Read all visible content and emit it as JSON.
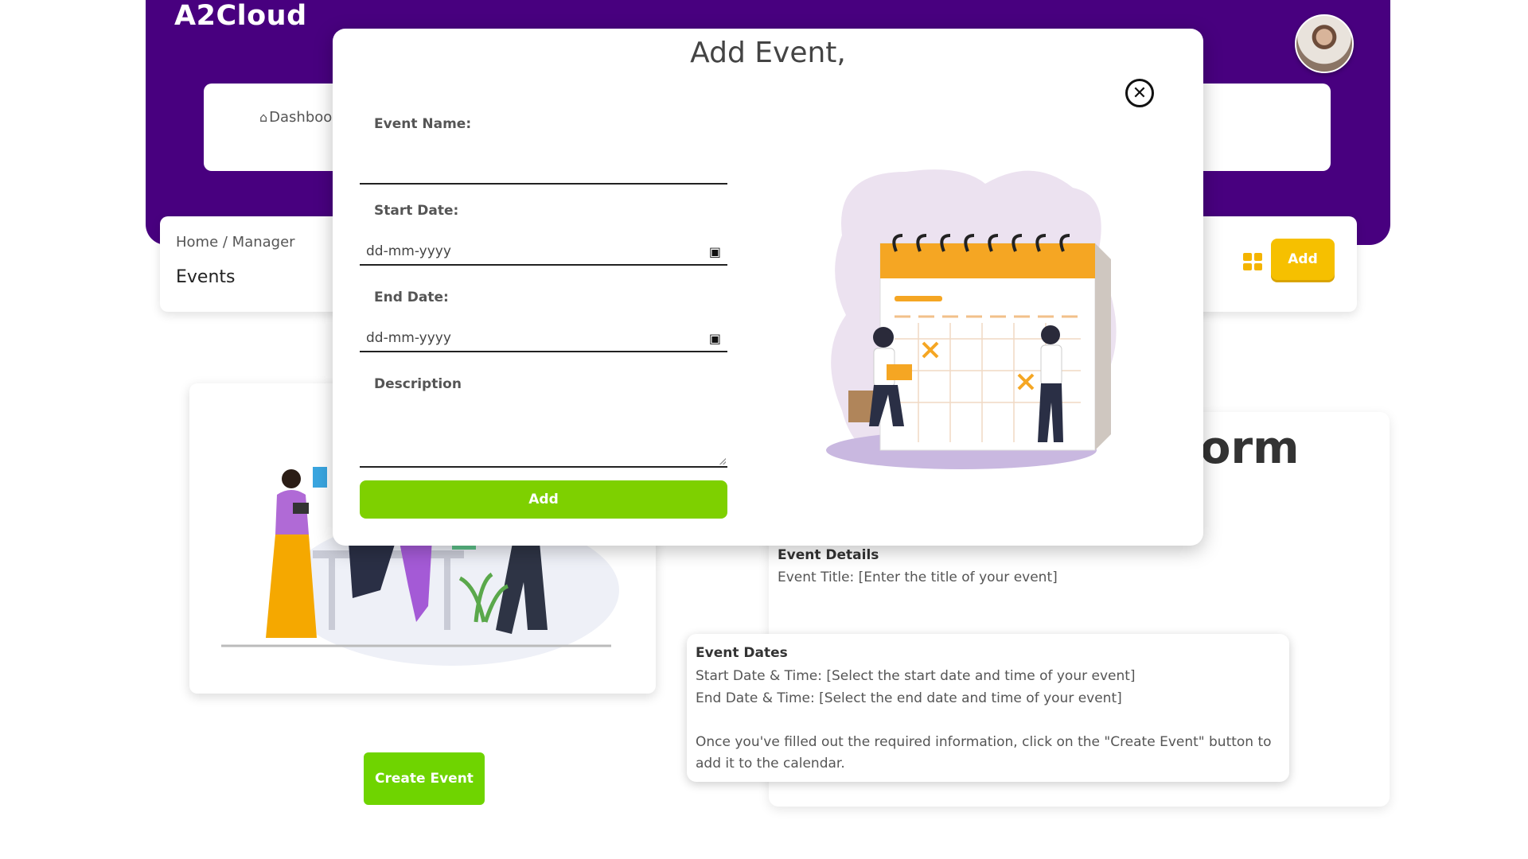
{
  "app": {
    "brand": "A2Cloud"
  },
  "nav": {
    "dashboard_label": "Dashboo"
  },
  "breadcrumb": {
    "text": "Home / Manager",
    "page_title": "Events",
    "add_label": "Add"
  },
  "background": {
    "form_heading_fragment": "orm",
    "details_title": "Event Details",
    "details_text": "Event Title: [Enter the title of your event]",
    "dates_title": "Event Dates",
    "dates_start": "Start Date & Time: [Select the start date and time of your event]",
    "dates_end": "End Date & Time: [Select the end date and time of your event]",
    "dates_note_1": "Once you've filled out the required information, click on the \"Create Event\" button to",
    "dates_note_2": "add it to the calendar.",
    "create_event_label": "Create Event"
  },
  "modal": {
    "title": "Add Event,",
    "event_name_label": "Event Name:",
    "event_name_value": "",
    "start_date_label": "Start Date:",
    "start_date_placeholder": "dd-mm-yyyy",
    "end_date_label": "End Date:",
    "end_date_placeholder": "dd-mm-yyyy",
    "description_label": "Description",
    "add_label": "Add",
    "close_icon": "close-circle-icon"
  },
  "colors": {
    "header": "#48007f",
    "accent_yellow": "#f6c000",
    "accent_green": "#7ed000"
  }
}
